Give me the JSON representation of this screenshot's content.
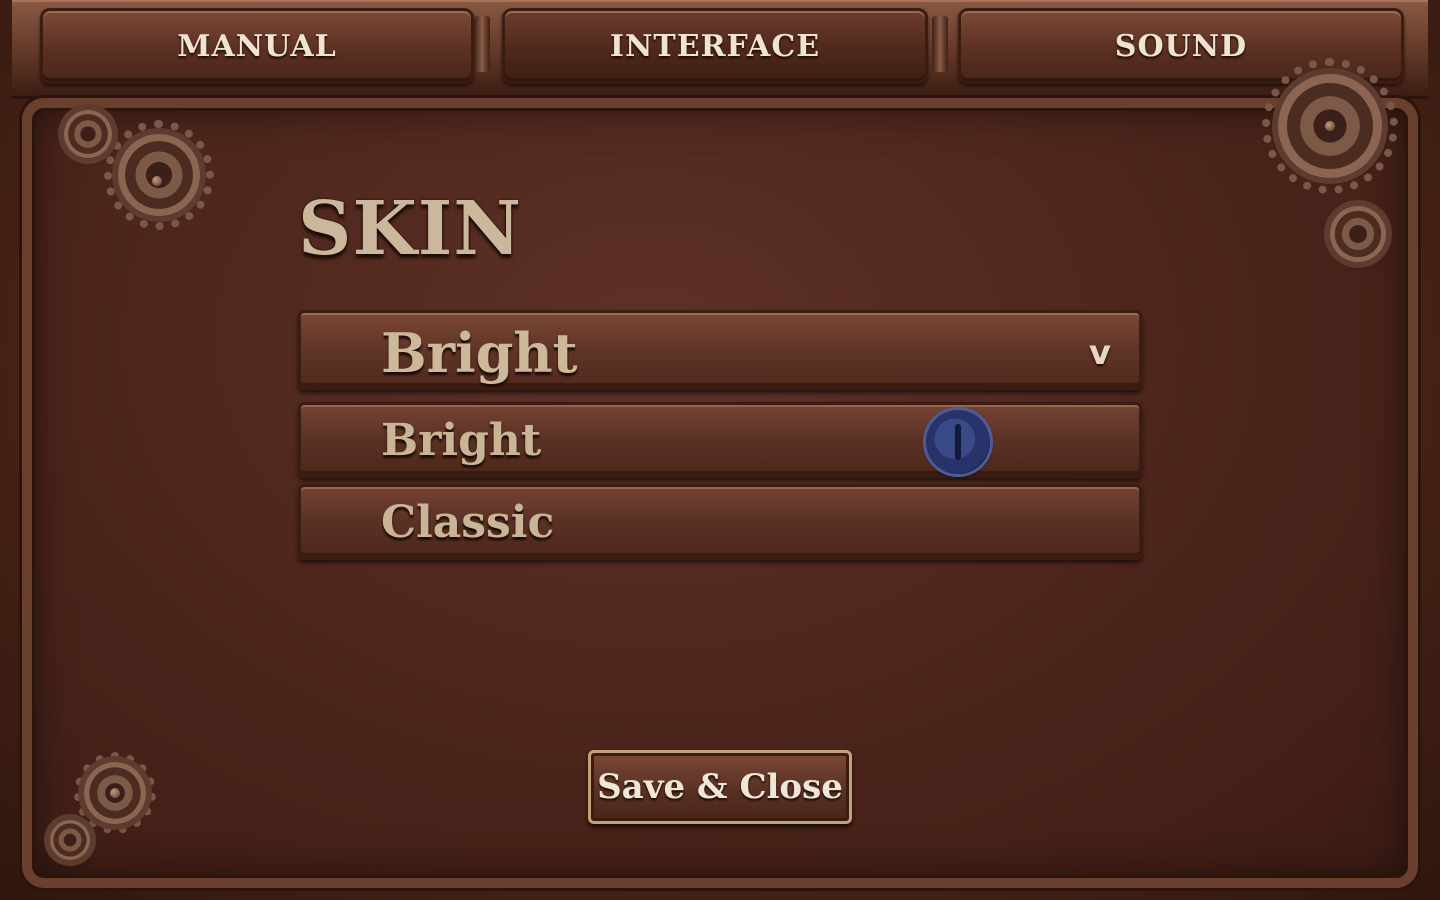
{
  "tabs": [
    {
      "label": "MANUAL"
    },
    {
      "label": "INTERFACE"
    },
    {
      "label": "SOUND"
    }
  ],
  "active_tab": "INTERFACE",
  "section": {
    "title": "SKIN"
  },
  "skin_dropdown": {
    "selected": "Bright",
    "chevron": "v",
    "options": [
      "Bright",
      "Classic"
    ]
  },
  "footer": {
    "save_label": "Save & Close"
  },
  "icons": {
    "gear": "gear-icon",
    "dropdown": "chevron-down-icon",
    "cursor": "cursor-knob-icon"
  },
  "colors": {
    "panel_background": "#4b241b",
    "text_primary": "#cbb79b",
    "button_text": "#f0e6d6",
    "cursor_knob": "#3a4a86"
  }
}
